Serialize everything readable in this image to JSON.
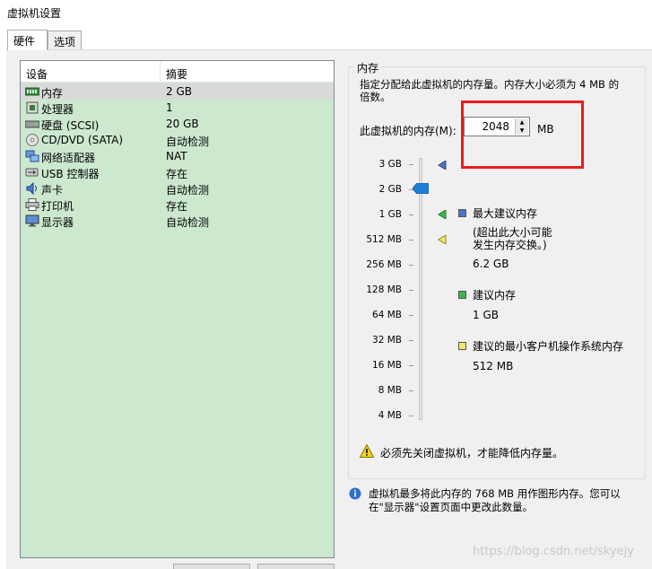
{
  "window": {
    "title": "虚拟机设置"
  },
  "tabs": [
    {
      "label": "硬件"
    },
    {
      "label": "选项"
    }
  ],
  "devices": {
    "col_device": "设备",
    "col_summary": "摘要",
    "items": [
      {
        "name": "内存",
        "summary": "2 GB",
        "icon": "memory-icon"
      },
      {
        "name": "处理器",
        "summary": "1",
        "icon": "cpu-icon"
      },
      {
        "name": "硬盘 (SCSI)",
        "summary": "20 GB",
        "icon": "harddisk-icon"
      },
      {
        "name": "CD/DVD (SATA)",
        "summary": "自动检测",
        "icon": "cd-dvd-icon"
      },
      {
        "name": "网络适配器",
        "summary": "NAT",
        "icon": "network-adapter-icon"
      },
      {
        "name": "USB 控制器",
        "summary": "存在",
        "icon": "usb-icon"
      },
      {
        "name": "声卡",
        "summary": "自动检测",
        "icon": "sound-card-icon"
      },
      {
        "name": "打印机",
        "summary": "存在",
        "icon": "printer-icon"
      },
      {
        "name": "显示器",
        "summary": "自动检测",
        "icon": "display-icon"
      }
    ]
  },
  "memory": {
    "group_title": "内存",
    "description": "指定分配给此虚拟机的内存量。内存大小必须为 4 MB 的倍数。",
    "field_label": "此虚拟机的内存(M):",
    "value": "2048",
    "unit": "MB",
    "scale": [
      "3 GB",
      "2 GB",
      "1 GB",
      "512 MB",
      "256 MB",
      "128 MB",
      "64 MB",
      "32 MB",
      "16 MB",
      "8 MB",
      "4 MB"
    ],
    "legend": {
      "max": {
        "title": "最大建议内存",
        "note1": "(超出此大小可能",
        "note2": "发生内存交换。)",
        "value": "6.2 GB"
      },
      "recommended": {
        "title": "建议内存",
        "value": "1 GB"
      },
      "min_os": {
        "title": "建议的最小客户机操作系统内存",
        "value": "512 MB"
      }
    },
    "warning": "必须先关闭虚拟机，才能降低内存量。",
    "info": "虚拟机最多将此内存的 768 MB 用作图形内存。您可以在\"显示器\"设置页面中更改此数量。"
  },
  "colors": {
    "list_bg": "#cce8cf",
    "highlight_box": "#ee1a1a",
    "slider_thumb": "#1e7fd6",
    "legend_max": "#4a74c4",
    "legend_recommended": "#3cb84a",
    "legend_min": "#f5e86a"
  },
  "watermark": "https://blog.csdn.net/skyejy"
}
